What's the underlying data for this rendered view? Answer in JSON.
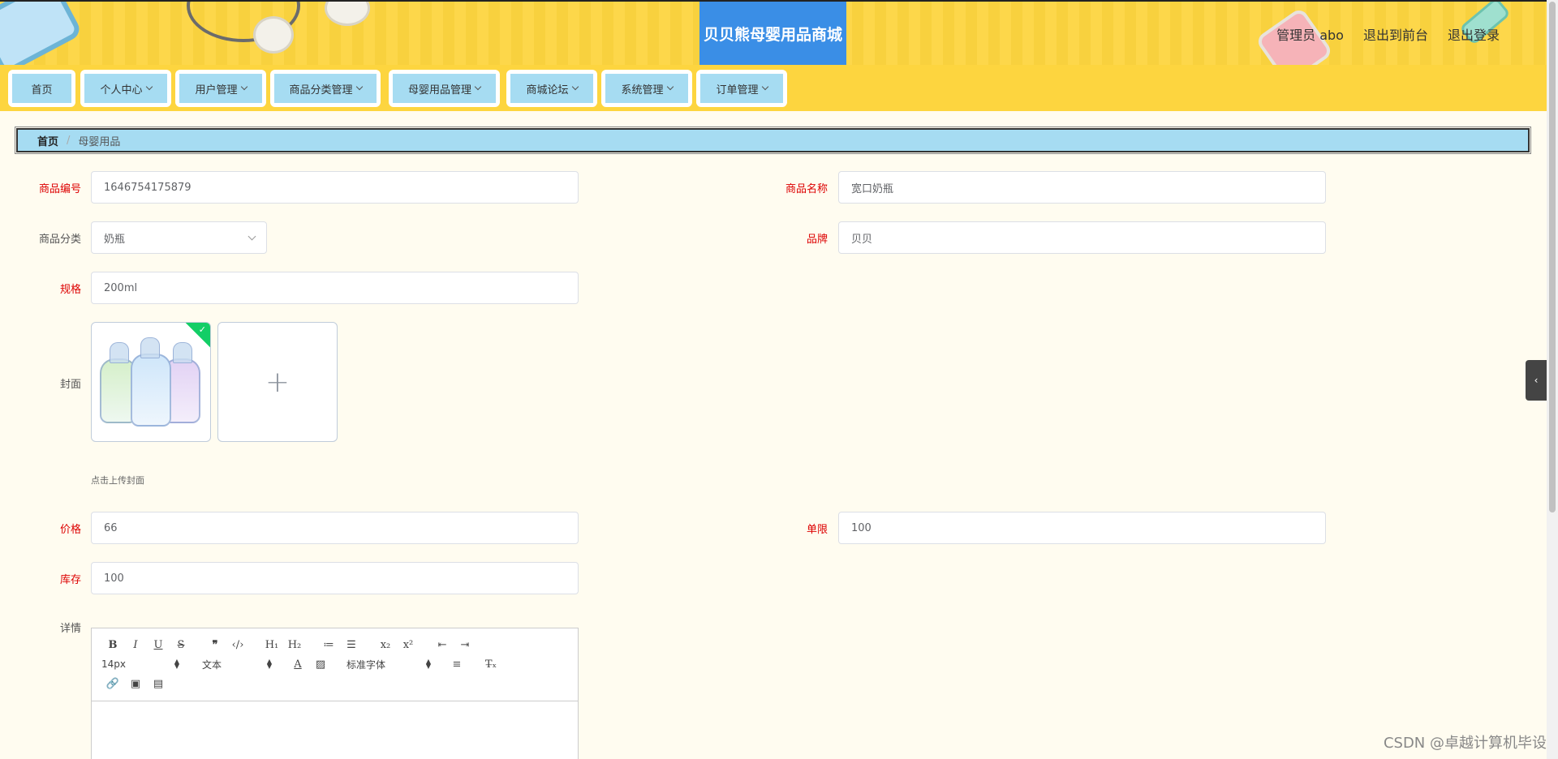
{
  "header": {
    "title": "贝贝熊母婴用品商城",
    "actions": [
      "管理员 abo",
      "退出到前台",
      "退出登录"
    ]
  },
  "nav": [
    {
      "label": "首页",
      "has_menu": false
    },
    {
      "label": "个人中心",
      "has_menu": true
    },
    {
      "label": "用户管理",
      "has_menu": true
    },
    {
      "label": "商品分类管理",
      "has_menu": true
    },
    {
      "label": "母婴用品管理",
      "has_menu": true
    },
    {
      "label": "商城论坛",
      "has_menu": true
    },
    {
      "label": "系统管理",
      "has_menu": true
    },
    {
      "label": "订单管理",
      "has_menu": true
    }
  ],
  "breadcrumb": {
    "home": "首页",
    "separator": "/",
    "current": "母婴用品"
  },
  "form": {
    "product_no": {
      "label": "商品编号",
      "value": "1646754175879"
    },
    "product_name": {
      "label": "商品名称",
      "value": "宽口奶瓶"
    },
    "category": {
      "label": "商品分类",
      "value": "奶瓶"
    },
    "brand": {
      "label": "品牌",
      "value": "贝贝"
    },
    "spec": {
      "label": "规格",
      "value": "200ml"
    },
    "cover": {
      "label": "封面",
      "hint": "点击上传封面",
      "add_icon": "plus-icon"
    },
    "price": {
      "label": "价格",
      "value": "66"
    },
    "limit": {
      "label": "单限",
      "value": "100"
    },
    "stock": {
      "label": "库存",
      "value": "100"
    },
    "detail": {
      "label": "详情"
    }
  },
  "editor": {
    "font_size": "14px",
    "text_style": "文本",
    "font_family": "标准字体"
  },
  "watermark": "CSDN @卓越计算机毕设",
  "colors": {
    "header_bg": "#fdd53f",
    "title_bg": "#3a8ee6",
    "nav_inner": "#a6dcf2",
    "required": "#dd0000",
    "success": "#13ce66"
  }
}
